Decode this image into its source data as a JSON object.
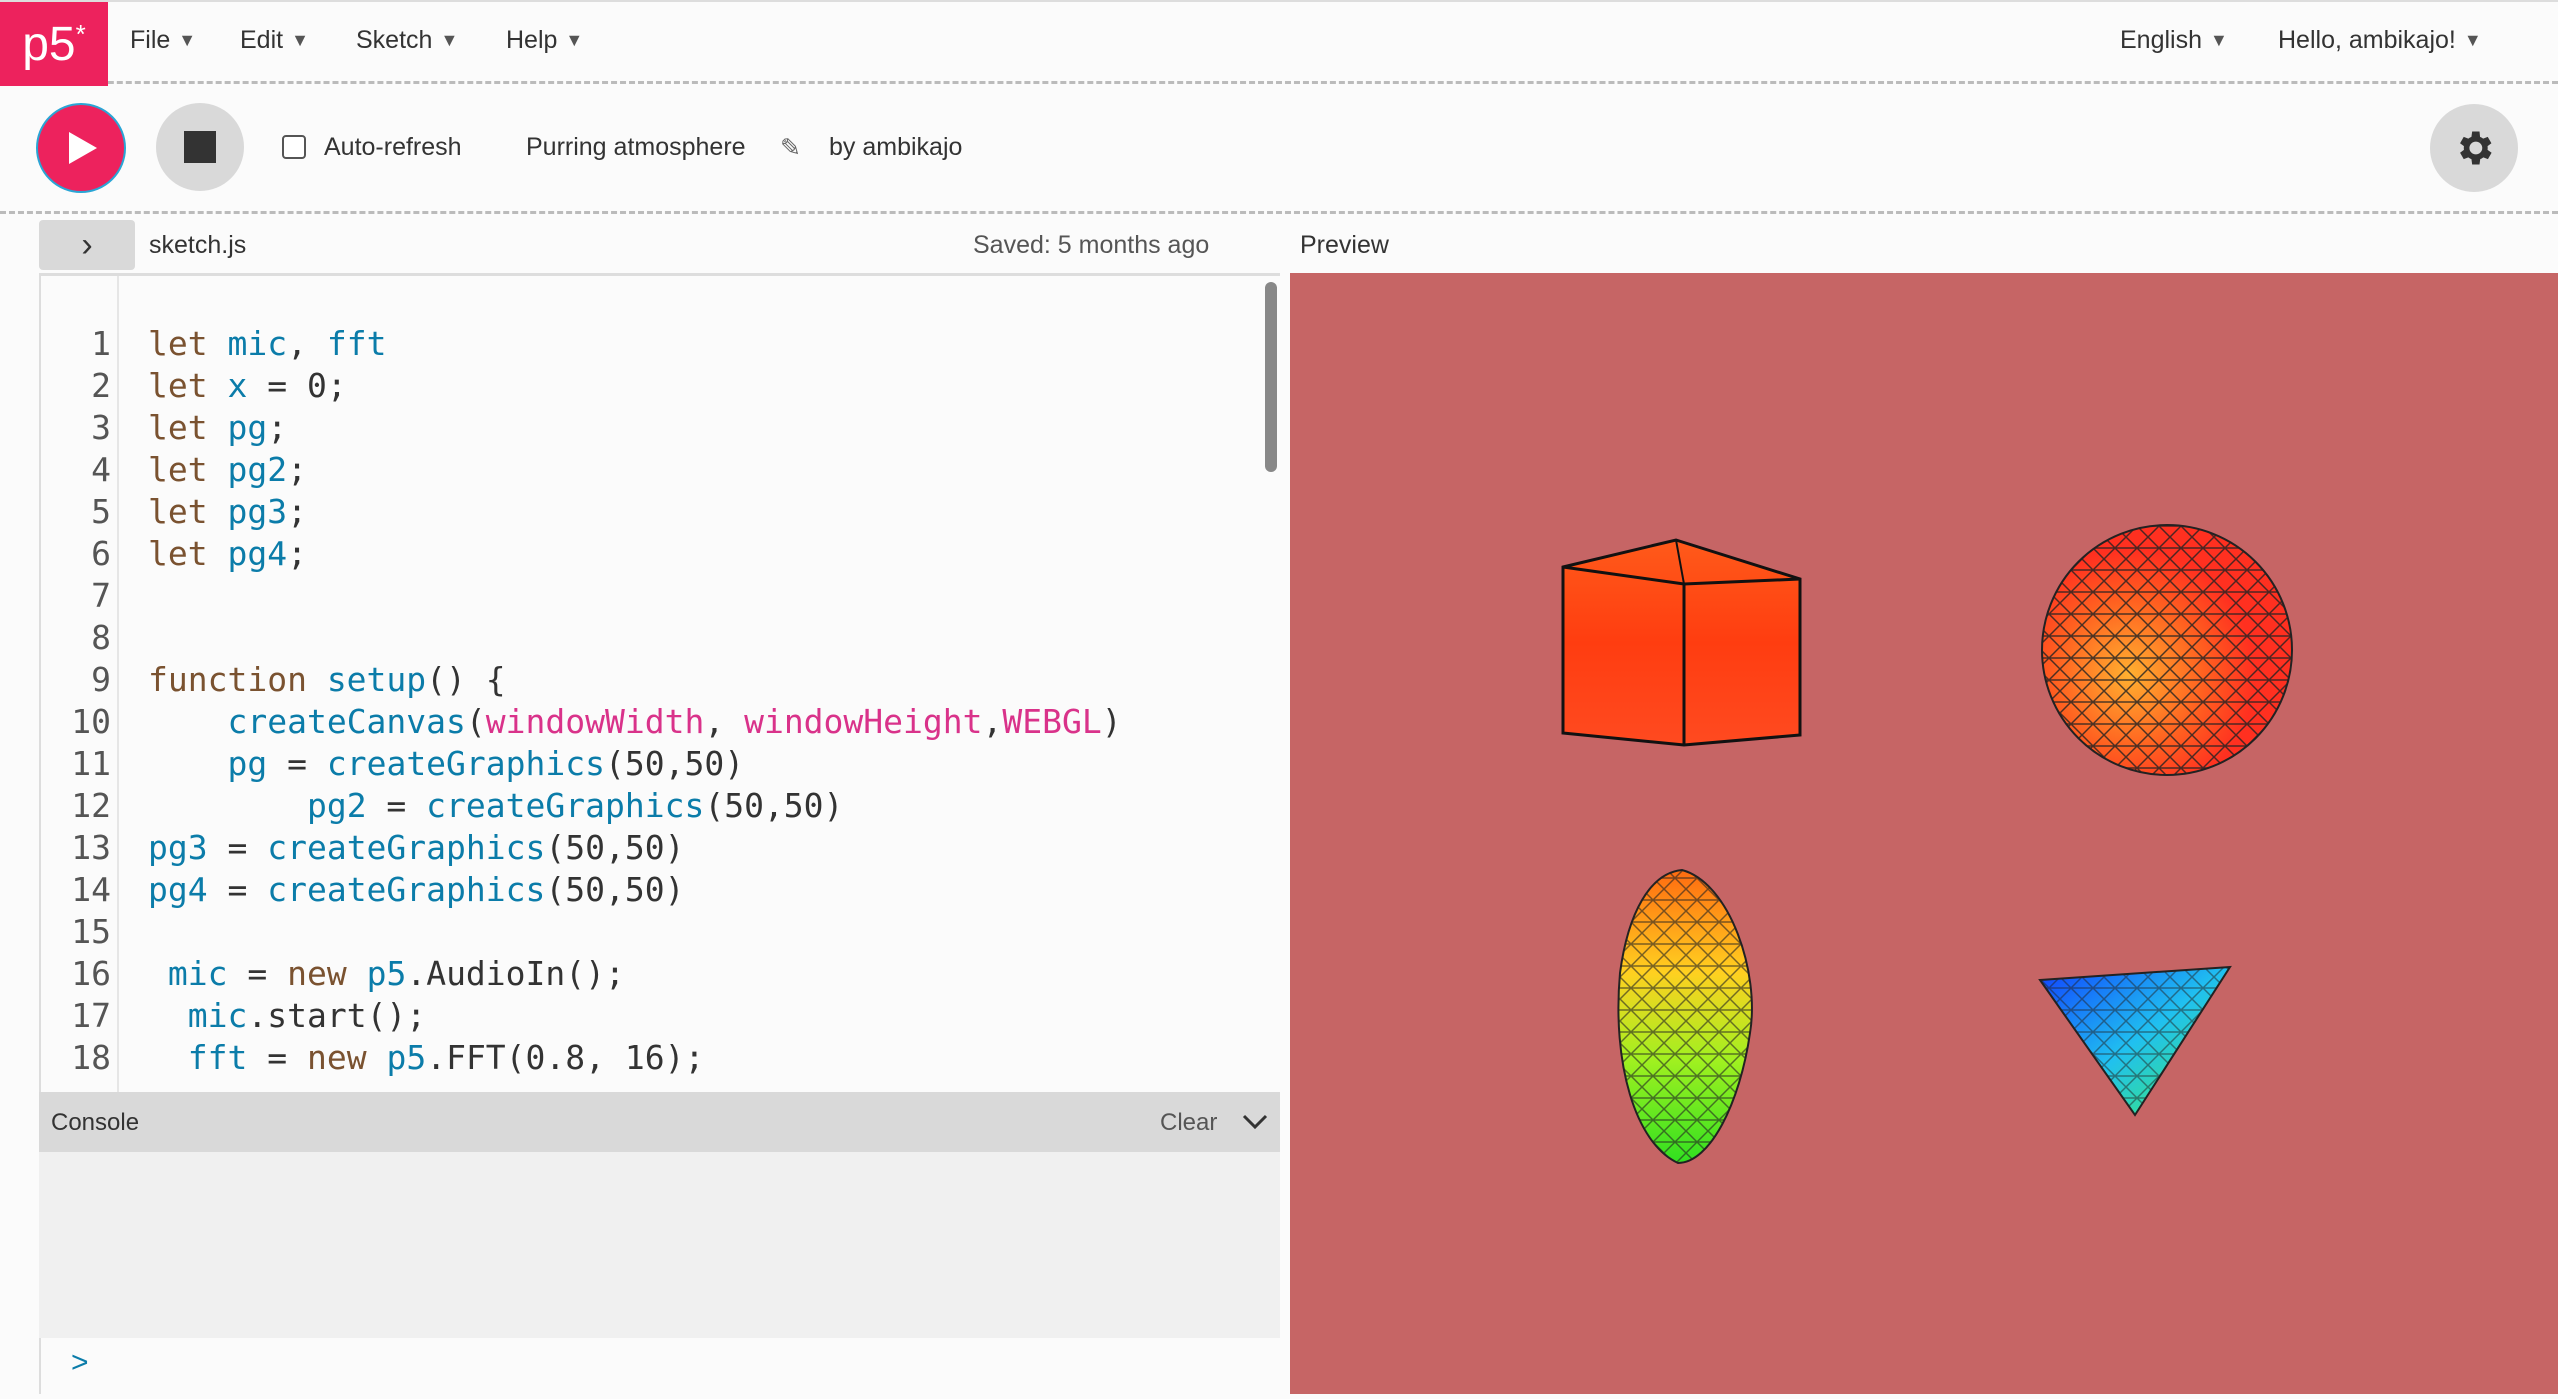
{
  "nav": {
    "logo": "p5",
    "logo_star": "*",
    "menus": [
      "File",
      "Edit",
      "Sketch",
      "Help"
    ],
    "language": "English",
    "user": "Hello, ambikajo!"
  },
  "toolbar": {
    "auto_refresh_label": "Auto-refresh",
    "auto_refresh_checked": false,
    "sketch_name": "Purring atmosphere",
    "author": "by ambikajo"
  },
  "editor": {
    "file_name": "sketch.js",
    "saved_status": "Saved: 5 months ago",
    "preview_label": "Preview",
    "lines": [
      [
        [
          "k",
          "let "
        ],
        [
          "v",
          "mic"
        ],
        [
          "d",
          ", "
        ],
        [
          "v",
          "fft"
        ]
      ],
      [
        [
          "k",
          "let "
        ],
        [
          "v",
          "x"
        ],
        [
          "d",
          " = 0;"
        ]
      ],
      [
        [
          "k",
          "let "
        ],
        [
          "v",
          "pg"
        ],
        [
          "d",
          ";"
        ]
      ],
      [
        [
          "k",
          "let "
        ],
        [
          "v",
          "pg2"
        ],
        [
          "d",
          ";"
        ]
      ],
      [
        [
          "k",
          "let "
        ],
        [
          "v",
          "pg3"
        ],
        [
          "d",
          ";"
        ]
      ],
      [
        [
          "k",
          "let "
        ],
        [
          "v",
          "pg4"
        ],
        [
          "d",
          ";"
        ]
      ],
      [],
      [],
      [
        [
          "k",
          "function "
        ],
        [
          "v",
          "setup"
        ],
        [
          "d",
          "() {"
        ]
      ],
      [
        [
          "d",
          "    "
        ],
        [
          "v",
          "createCanvas"
        ],
        [
          "d",
          "("
        ],
        [
          "p",
          "windowWidth"
        ],
        [
          "d",
          ", "
        ],
        [
          "p",
          "windowHeight"
        ],
        [
          "d",
          ","
        ],
        [
          "p",
          "WEBGL"
        ],
        [
          "d",
          ")"
        ]
      ],
      [
        [
          "d",
          "    "
        ],
        [
          "v",
          "pg"
        ],
        [
          "d",
          " = "
        ],
        [
          "v",
          "createGraphics"
        ],
        [
          "d",
          "(50,50)"
        ]
      ],
      [
        [
          "d",
          "        "
        ],
        [
          "v",
          "pg2"
        ],
        [
          "d",
          " = "
        ],
        [
          "v",
          "createGraphics"
        ],
        [
          "d",
          "(50,50)"
        ]
      ],
      [
        [
          "v",
          "pg3"
        ],
        [
          "d",
          " = "
        ],
        [
          "v",
          "createGraphics"
        ],
        [
          "d",
          "(50,50)"
        ]
      ],
      [
        [
          "v",
          "pg4"
        ],
        [
          "d",
          " = "
        ],
        [
          "v",
          "createGraphics"
        ],
        [
          "d",
          "(50,50)"
        ]
      ],
      [],
      [
        [
          "d",
          " "
        ],
        [
          "v",
          "mic"
        ],
        [
          "d",
          " = "
        ],
        [
          "k",
          "new "
        ],
        [
          "v",
          "p5"
        ],
        [
          "d",
          ".AudioIn();"
        ]
      ],
      [
        [
          "d",
          "  "
        ],
        [
          "v",
          "mic"
        ],
        [
          "d",
          ".start();"
        ]
      ],
      [
        [
          "d",
          "  "
        ],
        [
          "v",
          "fft"
        ],
        [
          "d",
          " = "
        ],
        [
          "k",
          "new "
        ],
        [
          "v",
          "p5"
        ],
        [
          "d",
          ".FFT(0.8, 16);"
        ]
      ]
    ]
  },
  "console": {
    "title": "Console",
    "clear_label": "Clear",
    "prompt": ">"
  },
  "colors": {
    "accent": "#ed225d",
    "preview_bg": "#c66565",
    "keyword": "#7a5230",
    "variable": "#0b7ca9",
    "builtin": "#d9328a",
    "text": "#333333"
  }
}
